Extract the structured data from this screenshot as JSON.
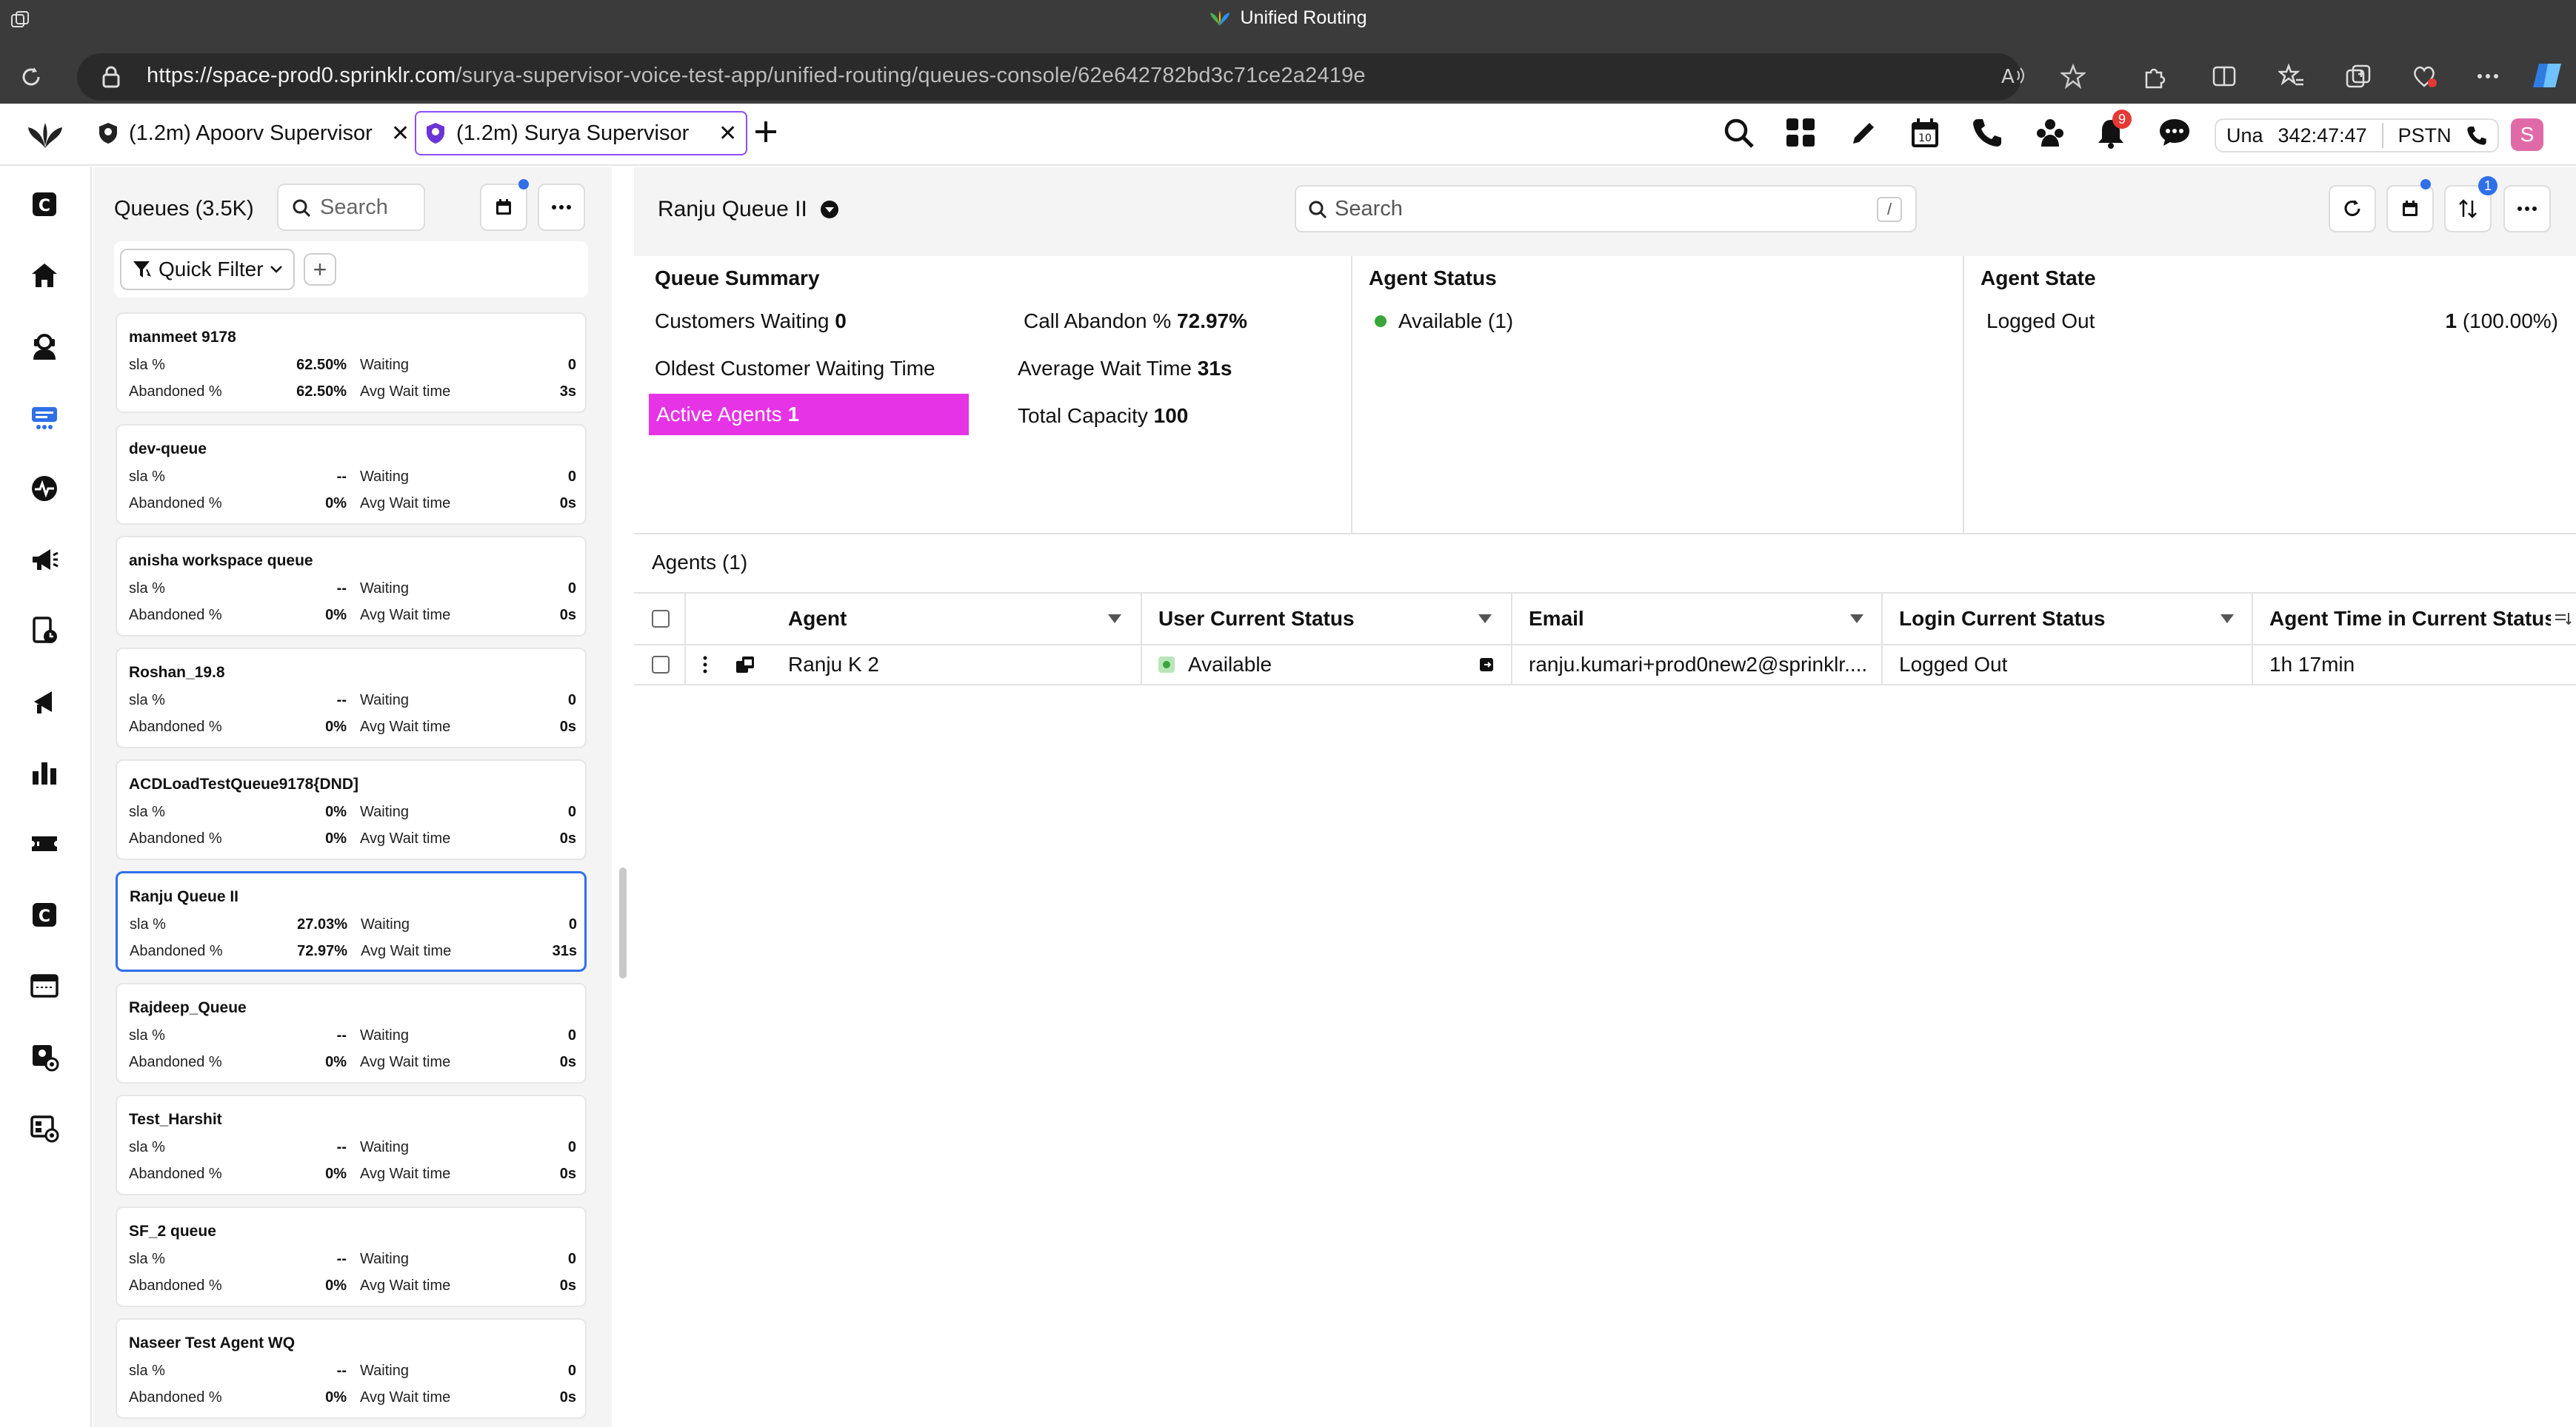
{
  "browser": {
    "window_title": "Unified Routing",
    "url_host": "https://space-prod0.sprinklr.com",
    "url_path": "/surya-supervisor-voice-test-app/unified-routing/queues-console/62e642782bd3c71ce2a2419e"
  },
  "tabs": [
    {
      "label": "(1.2m) Apoorv Supervisor",
      "active": false
    },
    {
      "label": "(1.2m) Surya Supervisor",
      "active": true
    }
  ],
  "header": {
    "notification_count": "9",
    "calendar_day": "10",
    "status_short": "Una",
    "timer": "342:47:47",
    "channel": "PSTN",
    "avatar_initial": "S"
  },
  "queues_panel": {
    "title": "Queues (3.5K)",
    "search_placeholder": "Search",
    "quick_filter": "Quick Filter",
    "labels": {
      "sla": "sla %",
      "abandoned": "Abandoned %",
      "waiting": "Waiting",
      "avg_wait": "Avg Wait time"
    },
    "items": [
      {
        "name": "manmeet 9178",
        "sla": "62.50%",
        "abandoned": "62.50%",
        "waiting": "0",
        "avg_wait": "3s"
      },
      {
        "name": "dev-queue",
        "sla": "--",
        "abandoned": "0%",
        "waiting": "0",
        "avg_wait": "0s"
      },
      {
        "name": "anisha workspace queue",
        "sla": "--",
        "abandoned": "0%",
        "waiting": "0",
        "avg_wait": "0s"
      },
      {
        "name": "Roshan_19.8",
        "sla": "--",
        "abandoned": "0%",
        "waiting": "0",
        "avg_wait": "0s"
      },
      {
        "name": "ACDLoadTestQueue9178{DND]",
        "sla": "0%",
        "abandoned": "0%",
        "waiting": "0",
        "avg_wait": "0s"
      },
      {
        "name": "Ranju Queue II",
        "sla": "27.03%",
        "abandoned": "72.97%",
        "waiting": "0",
        "avg_wait": "31s"
      },
      {
        "name": "Rajdeep_Queue",
        "sla": "--",
        "abandoned": "0%",
        "waiting": "0",
        "avg_wait": "0s"
      },
      {
        "name": "Test_Harshit",
        "sla": "--",
        "abandoned": "0%",
        "waiting": "0",
        "avg_wait": "0s"
      },
      {
        "name": "SF_2 queue",
        "sla": "--",
        "abandoned": "0%",
        "waiting": "0",
        "avg_wait": "0s"
      },
      {
        "name": "Naseer Test Agent WQ",
        "sla": "--",
        "abandoned": "0%",
        "waiting": "0",
        "avg_wait": "0s"
      }
    ]
  },
  "main": {
    "queue_name": "Ranju Queue II",
    "search_placeholder": "Search",
    "search_shortcut": "/",
    "sort_badge": "1",
    "queue_summary": {
      "title": "Queue Summary",
      "customers_waiting_label": "Customers Waiting",
      "customers_waiting": "0",
      "call_abandon_label": "Call Abandon %",
      "call_abandon": "72.97%",
      "oldest_label": "Oldest Customer Waiting Time",
      "avg_wait_label": "Average Wait Time",
      "avg_wait": "31s",
      "active_agents_label": "Active Agents",
      "active_agents": "1",
      "total_capacity_label": "Total Capacity",
      "total_capacity": "100"
    },
    "agent_status": {
      "title": "Agent Status",
      "available": "Available (1)"
    },
    "agent_state": {
      "title": "Agent State",
      "label": "Logged Out",
      "count": "1",
      "percent": "(100.00%)"
    },
    "agents_title": "Agents (1)",
    "columns": [
      "Agent",
      "User Current Status",
      "Email",
      "Login Current Status",
      "Agent Time in Current Status"
    ],
    "rows": [
      {
        "agent": "Ranju K 2",
        "status": "Available",
        "email": "ranju.kumari+prod0new2@sprinklr....",
        "login": "Logged Out",
        "time": "1h 17min"
      }
    ]
  },
  "colors": {
    "accent": "#8a4fff",
    "selected": "#2f6fe8",
    "active_agents": "#e633e6",
    "available": "#3aa53a",
    "badge": "#e53935"
  }
}
